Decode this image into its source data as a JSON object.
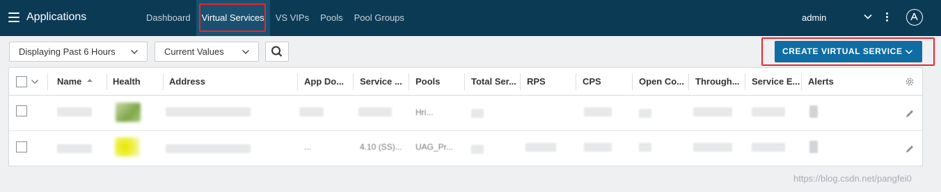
{
  "header": {
    "app_title": "Applications",
    "user": "admin",
    "nav": [
      "Dashboard",
      "Virtual Services",
      "VS VIPs",
      "Pools",
      "Pool Groups"
    ],
    "active_nav": "Virtual Services"
  },
  "filters": {
    "time_range": "Displaying Past 6 Hours",
    "value_mode": "Current Values"
  },
  "actions": {
    "create_label": "CREATE VIRTUAL SERVICE"
  },
  "table": {
    "columns": [
      "Name",
      "Health",
      "Address",
      "App Do...",
      "Service ...",
      "Pools",
      "Total Ser...",
      "RPS",
      "CPS",
      "Open Co...",
      "Through...",
      "Service E...",
      "Alerts"
    ],
    "sorted_column": "Name",
    "rows": [
      {
        "pools": "Hri..."
      },
      {
        "app_domain": "...",
        "service": "4.10 (SS)...",
        "pools": "UAG_Pr..."
      }
    ]
  },
  "colors": {
    "topbar": "#0b3a55",
    "primary": "#0f6da3",
    "highlight": "#e8262b"
  },
  "icons": [
    "menu-icon",
    "chevron-down-icon",
    "kebab-icon",
    "brand-logo-icon",
    "search-icon",
    "settings-gear-icon",
    "edit-pencil-icon",
    "sort-asc-icon"
  ],
  "watermark": "https://blog.csdn.net/pangfei0"
}
